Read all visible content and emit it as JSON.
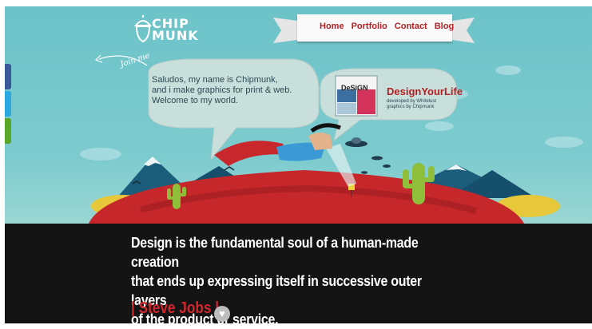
{
  "brand": {
    "logo_line1": "CHIP",
    "logo_line2": "MUNK"
  },
  "nav": {
    "items": [
      "Home",
      "Portfolio",
      "Contact",
      "Blog"
    ]
  },
  "intro": {
    "join_label": "Join me",
    "greeting": [
      "Saludos, my name is  Chipmunk,",
      "and i make graphics for print & web.",
      "Welcome to my world."
    ]
  },
  "portfolio": {
    "thumb_label": "DeSiGN",
    "title": "DesignYourLife",
    "developed": "developed by Whitelust",
    "graphics": "graphics by Chipmunk"
  },
  "quote": {
    "lines": [
      "Design is the fundamental soul of a human-made creation",
      "that ends up expressing itself in successive outer layers",
      "of the product or service."
    ],
    "author": "| Steve Jobs |"
  },
  "colors": {
    "sky": "#6cc3c8",
    "accent": "#b51f22",
    "quote_bg": "#141414",
    "side_tabs": [
      "#3b5998",
      "#2aa9e0",
      "#5ba829"
    ]
  },
  "icons": {
    "heart": "heart-icon",
    "acorn": "acorn-logo-icon"
  }
}
